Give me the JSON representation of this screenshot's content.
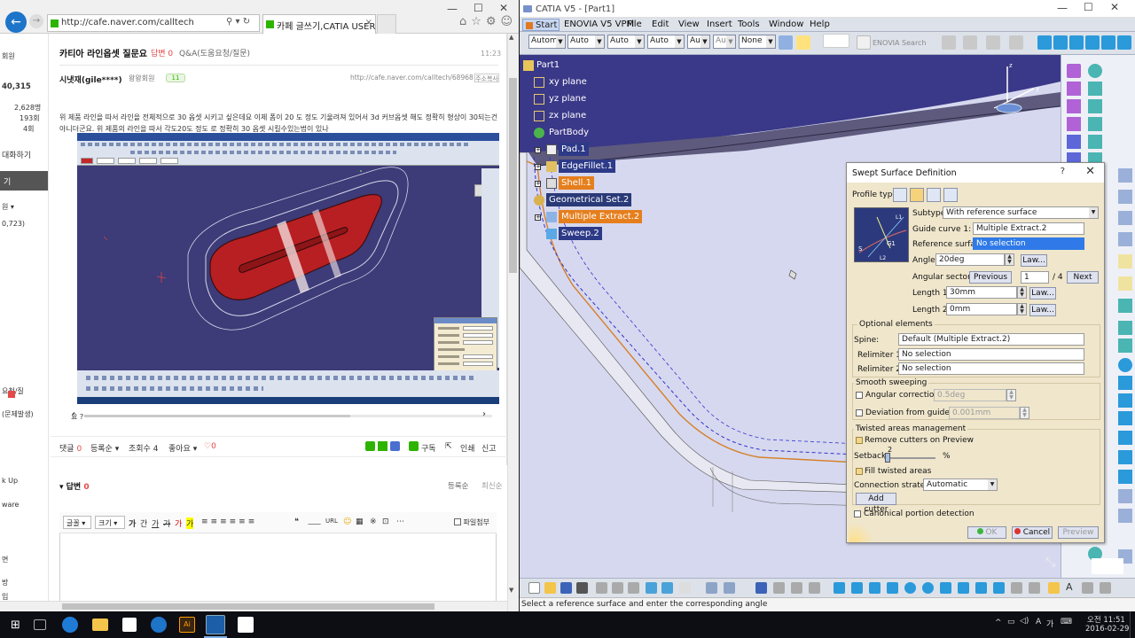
{
  "browser": {
    "address": "http://cafe.naver.com/calltech",
    "tab_title": "카페 글쓰기,CATIA USER ...",
    "sidebar": {
      "items": [
        "회원",
        "40,315",
        "2,628명",
        "193회",
        "4회",
        "대화하기",
        "기",
        "원 ▾",
        "0,723)",
        "요청/질",
        "(문제발생)",
        "k Up",
        "ware",
        "면",
        "방",
        "입"
      ]
    },
    "article": {
      "title": "카티아 라인옵셋 질문요",
      "answer_label": "답변 0",
      "category": "Q&A(도움요청/질문)",
      "time": "11:23",
      "author": "시냇재(gile****)",
      "grade": "왕왕회원",
      "badge": "11",
      "url": "http://cafe.naver.com/calltech/68968",
      "copy_label": "주소복사",
      "body": "위 제품 라인을 따서  라인을 전체적으로 30 옵셋 시키고 싶은데요  이제 폼이 20 도 정도 기울려져 있어서 3d 커브옵셋 해도 정확히 형상이 30되는건 아니더군요. 위 제품의 라인을 따서 각도20도 정도 로 정확히 30 옵셋 시킬수있는법이 있나",
      "tail_text": "요 ?"
    },
    "meta": {
      "comment_label": "댓글",
      "comment_count": "0",
      "register_label": "등록순 ▾",
      "view_label": "조회수 4",
      "like_label": "좋아요 ▾",
      "like_count": "♡0",
      "subscribe": "구독",
      "print": "인쇄",
      "report": "신고"
    },
    "reply": {
      "title": "답변",
      "count": "0",
      "sort1": "등록순",
      "sort2": "최신순",
      "font_select": "글꼴 ▾",
      "size_select": "크기 ▾",
      "tool_buttons": [
        "가",
        "간",
        "가",
        "가",
        "가",
        "가"
      ],
      "attach": "파일첨부"
    }
  },
  "catia": {
    "window_title": "CATIA V5 - [Part1]",
    "menu": [
      "Start",
      "ENOVIA V5 VPM",
      "File",
      "Edit",
      "View",
      "Insert",
      "Tools",
      "Window",
      "Help"
    ],
    "toolbar_dropdowns": [
      "Autom",
      "Auto",
      "Auto",
      "Auto",
      "Au",
      "Au",
      "None"
    ],
    "enovia_search": "ENOVIA Search",
    "tree": [
      "Part1",
      "xy plane",
      "yz plane",
      "zx plane",
      "PartBody",
      "Pad.1",
      "EdgeFillet.1",
      "Shell.1",
      "Geometrical Set.2",
      "Multiple Extract.2",
      "Sweep.2"
    ],
    "status": "Select a reference surface and enter the corresponding angle",
    "dialog": {
      "title": "Swept Surface Definition",
      "help": "?",
      "profile_type": "Profile type:",
      "subtype_label": "Subtype:",
      "subtype_value": "With reference surface",
      "guide_label": "Guide curve 1:",
      "guide_value": "Multiple Extract.2",
      "refsurf_label": "Reference surface:",
      "refsurf_value": "No selection",
      "angle_label": "Angle:",
      "angle_value": "20deg",
      "law": "Law...",
      "angsector_label": "Angular sector:",
      "previous": "Previous",
      "sector_value": "1",
      "sector_total": "/ 4",
      "next": "Next",
      "length1_label": "Length 1:",
      "length1_value": "30mm",
      "length2_label": "Length 2:",
      "length2_value": "0mm",
      "optional": "Optional elements",
      "spine_label": "Spine:",
      "spine_value": "Default (Multiple Extract.2)",
      "relim1_label": "Relimiter 1:",
      "relim1_value": "No selection",
      "relim2_label": "Relimiter 2:",
      "relim2_value": "No selection",
      "smooth": "Smooth sweeping",
      "angcorr_label": "Angular correction:",
      "angcorr_value": "0.5deg",
      "deviation_label": "Deviation from guide(s):",
      "deviation_value": "0.001mm",
      "twisted": "Twisted areas management",
      "remove_cutters": "Remove cutters on Preview",
      "setback_label": "Setback",
      "setback_value": "2",
      "setback_unit": "%",
      "fill_twisted": "Fill twisted areas",
      "connection_label": "Connection strategy:",
      "connection_value": "Automatic",
      "add_cutter": "Add cutter",
      "canonical": "Canonical portion detection",
      "ok": "OK",
      "cancel": "Cancel",
      "preview": "Preview"
    }
  },
  "taskbar": {
    "ampm_time": "오전 11:51",
    "date": "2016-02-29",
    "lang": "A",
    "ime": "가"
  }
}
